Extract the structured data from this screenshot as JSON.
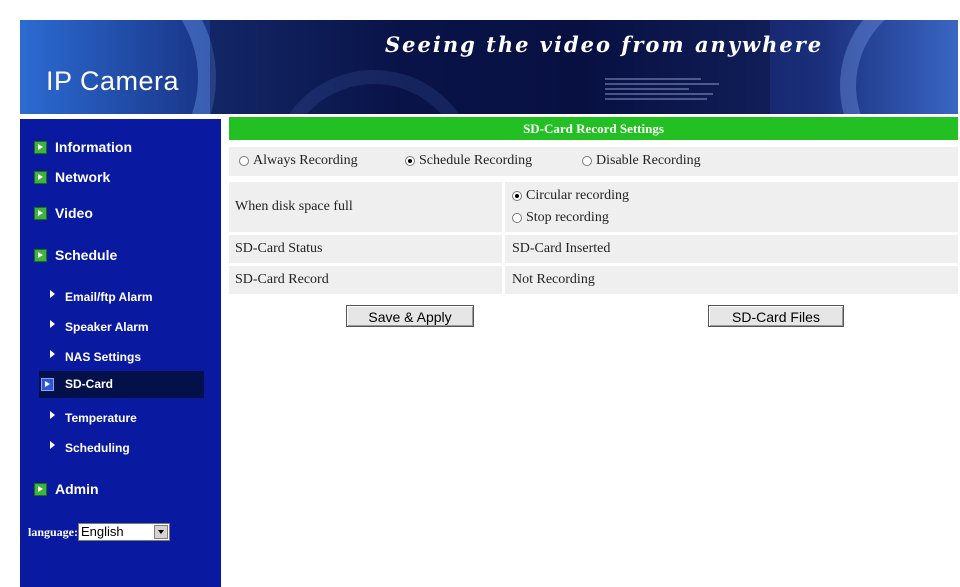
{
  "header": {
    "brand": "IP Camera",
    "tagline": "Seeing the video from anywhere"
  },
  "sidebar": {
    "main_items": [
      {
        "label": "Information"
      },
      {
        "label": "Network"
      },
      {
        "label": "Video"
      },
      {
        "label": "Schedule"
      },
      {
        "label": "Admin"
      }
    ],
    "sub_items": [
      {
        "label": "Email/ftp Alarm"
      },
      {
        "label": "Speaker Alarm"
      },
      {
        "label": "NAS Settings"
      },
      {
        "label": "SD-Card"
      },
      {
        "label": "Temperature"
      },
      {
        "label": "Scheduling"
      }
    ],
    "active_item": "SD-Card",
    "language_label": "language:",
    "language_value": "English"
  },
  "panel": {
    "title": "SD-Card Record Settings",
    "modes": [
      {
        "label": "Always Recording",
        "selected": false
      },
      {
        "label": "Schedule Recording",
        "selected": true
      },
      {
        "label": "Disable Recording",
        "selected": false
      }
    ],
    "disk_full": {
      "label": "When disk space full",
      "options": [
        {
          "label": "Circular recording",
          "selected": true
        },
        {
          "label": "Stop recording",
          "selected": false
        }
      ]
    },
    "status": {
      "label": "SD-Card Status",
      "value": "SD-Card Inserted"
    },
    "record": {
      "label": "SD-Card Record",
      "value": "Not Recording"
    },
    "buttons": {
      "save": "Save & Apply",
      "files": "SD-Card Files"
    }
  },
  "colors": {
    "sidebar_bg": "#0a1aa0",
    "title_bar": "#22c022",
    "active_item_bg": "#04104a"
  }
}
